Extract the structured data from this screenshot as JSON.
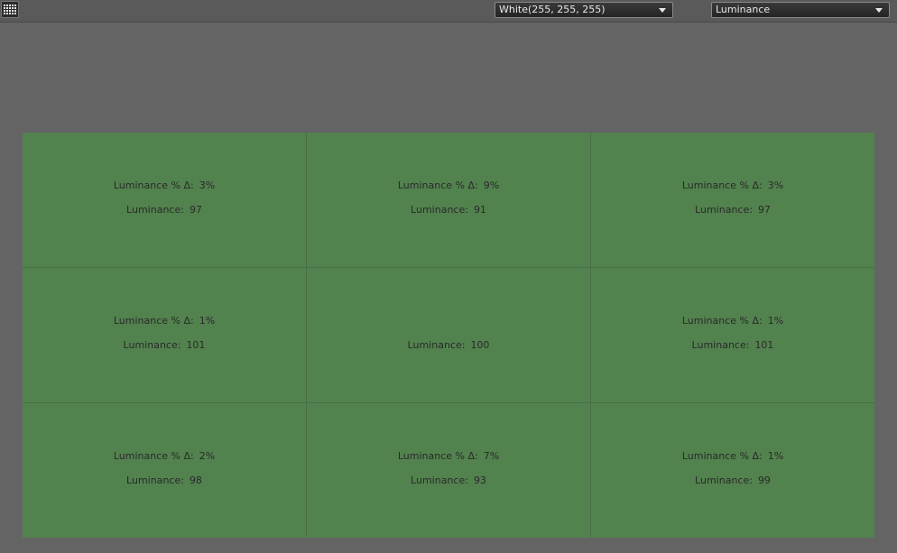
{
  "toolbar": {
    "grid_button_icon": "grid-icon",
    "color_select": {
      "value": "White(255, 255, 255)"
    },
    "metric_select": {
      "value": "Luminance"
    }
  },
  "grid": {
    "cell_color": "#52824e",
    "cells": [
      {
        "delta_label": "Luminance % Δ:",
        "delta_value": "3%",
        "lum_label": "Luminance:",
        "lum_value": "97"
      },
      {
        "delta_label": "Luminance % Δ:",
        "delta_value": "9%",
        "lum_label": "Luminance:",
        "lum_value": "91"
      },
      {
        "delta_label": "Luminance % Δ:",
        "delta_value": "3%",
        "lum_label": "Luminance:",
        "lum_value": "97"
      },
      {
        "delta_label": "Luminance % Δ:",
        "delta_value": "1%",
        "lum_label": "Luminance:",
        "lum_value": "101"
      },
      {
        "delta_label": "",
        "delta_value": "",
        "lum_label": "Luminance:",
        "lum_value": "100"
      },
      {
        "delta_label": "Luminance % Δ:",
        "delta_value": "1%",
        "lum_label": "Luminance:",
        "lum_value": "101"
      },
      {
        "delta_label": "Luminance % Δ:",
        "delta_value": "2%",
        "lum_label": "Luminance:",
        "lum_value": "98"
      },
      {
        "delta_label": "Luminance % Δ:",
        "delta_value": "7%",
        "lum_label": "Luminance:",
        "lum_value": "93"
      },
      {
        "delta_label": "Luminance % Δ:",
        "delta_value": "1%",
        "lum_label": "Luminance:",
        "lum_value": "99"
      }
    ]
  }
}
